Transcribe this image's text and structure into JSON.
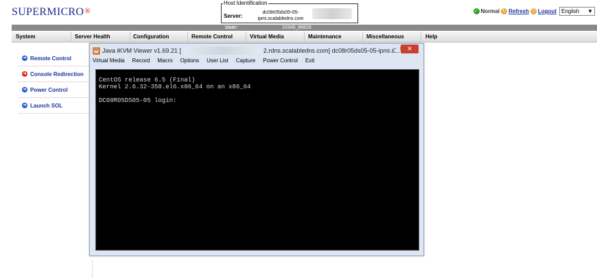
{
  "logo": {
    "text": "SUPERMICRO",
    "reg": "®"
  },
  "host": {
    "legend": "Host Identification",
    "server_label": "Server:",
    "server_value_1": "dc08r05ds05-05-",
    "server_value_2": "ipmi.scalabledns.com"
  },
  "topbar": {
    "status": "Normal",
    "refresh": "Refresh",
    "logout": "Logout",
    "language": "English",
    "dropdown": "▼"
  },
  "userbar": {
    "label": "User:",
    "value": "10346_66816"
  },
  "menu": [
    "System",
    "Server Health",
    "Configuration",
    "Remote Control",
    "Virtual Media",
    "Maintenance",
    "Miscellaneous",
    "Help"
  ],
  "sidebar": [
    {
      "label": "Remote Control"
    },
    {
      "label": "Console Redirection"
    },
    {
      "label": "Power Control"
    },
    {
      "label": "Launch SOL"
    }
  ],
  "kvm": {
    "title_left": "Java iKVM Viewer v1.69.21 [",
    "title_right": "2.rdns.scalabledns.com] dc08r05ds05-05-ipmi.s...",
    "minimize": "–",
    "maximize": "▢",
    "close": "✕",
    "menu": [
      "Virtual Media",
      "Record",
      "Macro",
      "Options",
      "User List",
      "Capture",
      "Power Control",
      "Exit"
    ],
    "console": "CentOS release 6.5 (Final)\nKernel 2.6.32-358.el6.x86_64 on an x86_64\n\nDC08R05DS05-05 login:"
  },
  "colors": {
    "logo": "#1b2a8a",
    "accent_link": "#1a33a0",
    "kvm_close": "#c9402e",
    "console_bg": "#000000"
  }
}
